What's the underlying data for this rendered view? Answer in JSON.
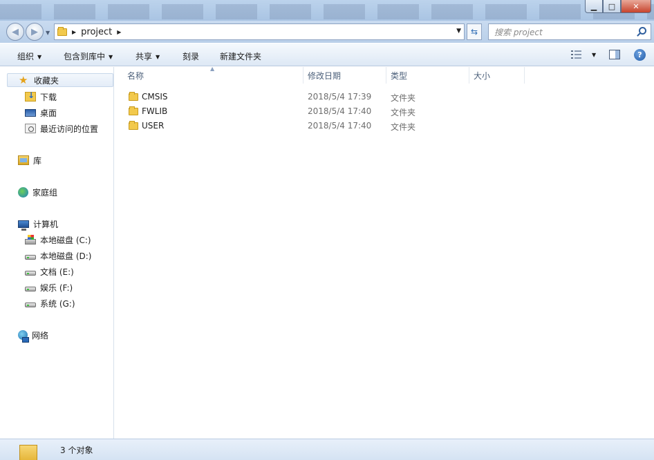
{
  "window": {
    "minimize": "▁",
    "maximize": "□",
    "close": "✕"
  },
  "address": {
    "segments": [
      "project"
    ],
    "search_placeholder": "搜索 project"
  },
  "toolbar": {
    "organize": "组织",
    "include_in_library": "包含到库中",
    "share": "共享",
    "burn": "刻录",
    "new_folder": "新建文件夹",
    "help": "?"
  },
  "nav": {
    "favorites": {
      "label": "收藏夹",
      "items": [
        "下载",
        "桌面",
        "最近访问的位置"
      ]
    },
    "libraries": "库",
    "homegroup": "家庭组",
    "computer": {
      "label": "计算机",
      "drives": [
        "本地磁盘 (C:)",
        "本地磁盘 (D:)",
        "文档 (E:)",
        "娱乐 (F:)",
        "系统 (G:)"
      ]
    },
    "network": "网络"
  },
  "columns": {
    "name": "名称",
    "date": "修改日期",
    "type": "类型",
    "size": "大小"
  },
  "files": [
    {
      "name": "CMSIS",
      "date": "2018/5/4 17:39",
      "type": "文件夹"
    },
    {
      "name": "FWLIB",
      "date": "2018/5/4 17:40",
      "type": "文件夹"
    },
    {
      "name": "USER",
      "date": "2018/5/4 17:40",
      "type": "文件夹"
    }
  ],
  "status": {
    "count_text": "3 个对象"
  }
}
